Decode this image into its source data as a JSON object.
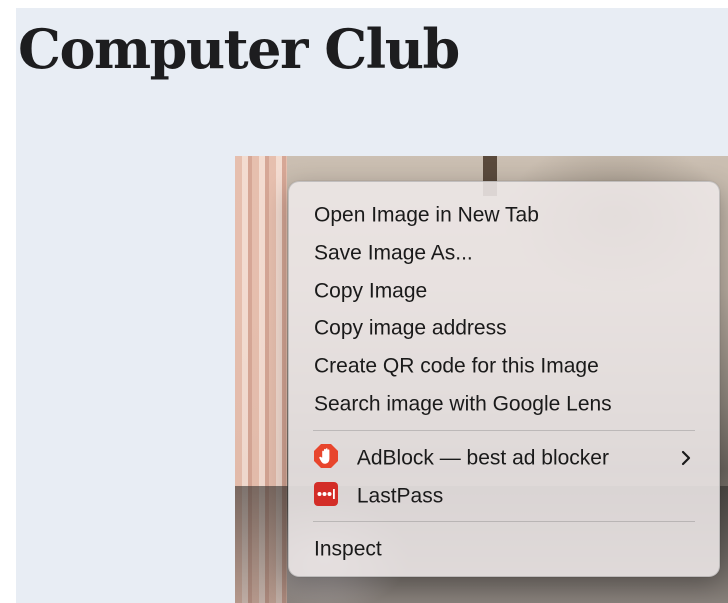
{
  "page": {
    "title": "Computer Club"
  },
  "context_menu": {
    "items": [
      {
        "label": "Open Image in New Tab"
      },
      {
        "label": "Save Image As..."
      },
      {
        "label": "Copy Image"
      },
      {
        "label": "Copy image address"
      },
      {
        "label": "Create QR code for this Image"
      },
      {
        "label": "Search image with Google Lens"
      }
    ],
    "extensions": [
      {
        "label": "AdBlock — best ad blocker",
        "icon": "adblock-hand-icon",
        "has_submenu": true
      },
      {
        "label": "LastPass",
        "icon": "lastpass-icon",
        "has_submenu": false
      }
    ],
    "inspect_label": "Inspect"
  },
  "colors": {
    "page_background": "#e8edf4",
    "title_text": "#1d1d1f",
    "adblock_red": "#e8452c",
    "lastpass_red": "#d32d27",
    "menu_background": "#eee8e8"
  }
}
